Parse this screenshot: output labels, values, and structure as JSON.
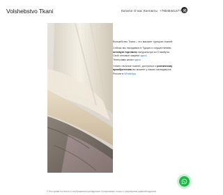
{
  "header": {
    "logo": "Volshebstvo Tkani",
    "nav": {
      "catalog": "Каталог",
      "about": "О нас",
      "contacts": "Контакты"
    },
    "phone": "+79045441477",
    "social_icon": "instagram-icon"
  },
  "intro": {
    "line1": "Волшебство Ткани – это магазин турецких тканей.",
    "p2_line1": "Сейчас мы находимся в Турции и осуществляем",
    "p2_line2_bold": "оптовую торговлю",
    "p2_line2_rest": " натуральную из Стамбула.",
    "p2_line3": "Свой оптовые закупки ",
    "p2_line3_link": "здесь",
    "p2_line4": "Телеграмм канал ",
    "p2_line4_link": "здесь",
    "p3_line1_pre": "Узнать наличие тканей, доступных к ",
    "p3_line1_bold": "розничному",
    "p3_line2_bold": "приобретению",
    "p3_line2_rest": " вы можете у наших менеджеров",
    "p3_line3": "России в ",
    "p3_line3_link": "WhatsApp"
  },
  "footer": {
    "text": "© Все права на тексты и изображения принадлежат. Копирование только с разрешения правообладателя"
  },
  "colors": {
    "link": "#2a7bd1",
    "whatsapp": "#25b34b"
  }
}
